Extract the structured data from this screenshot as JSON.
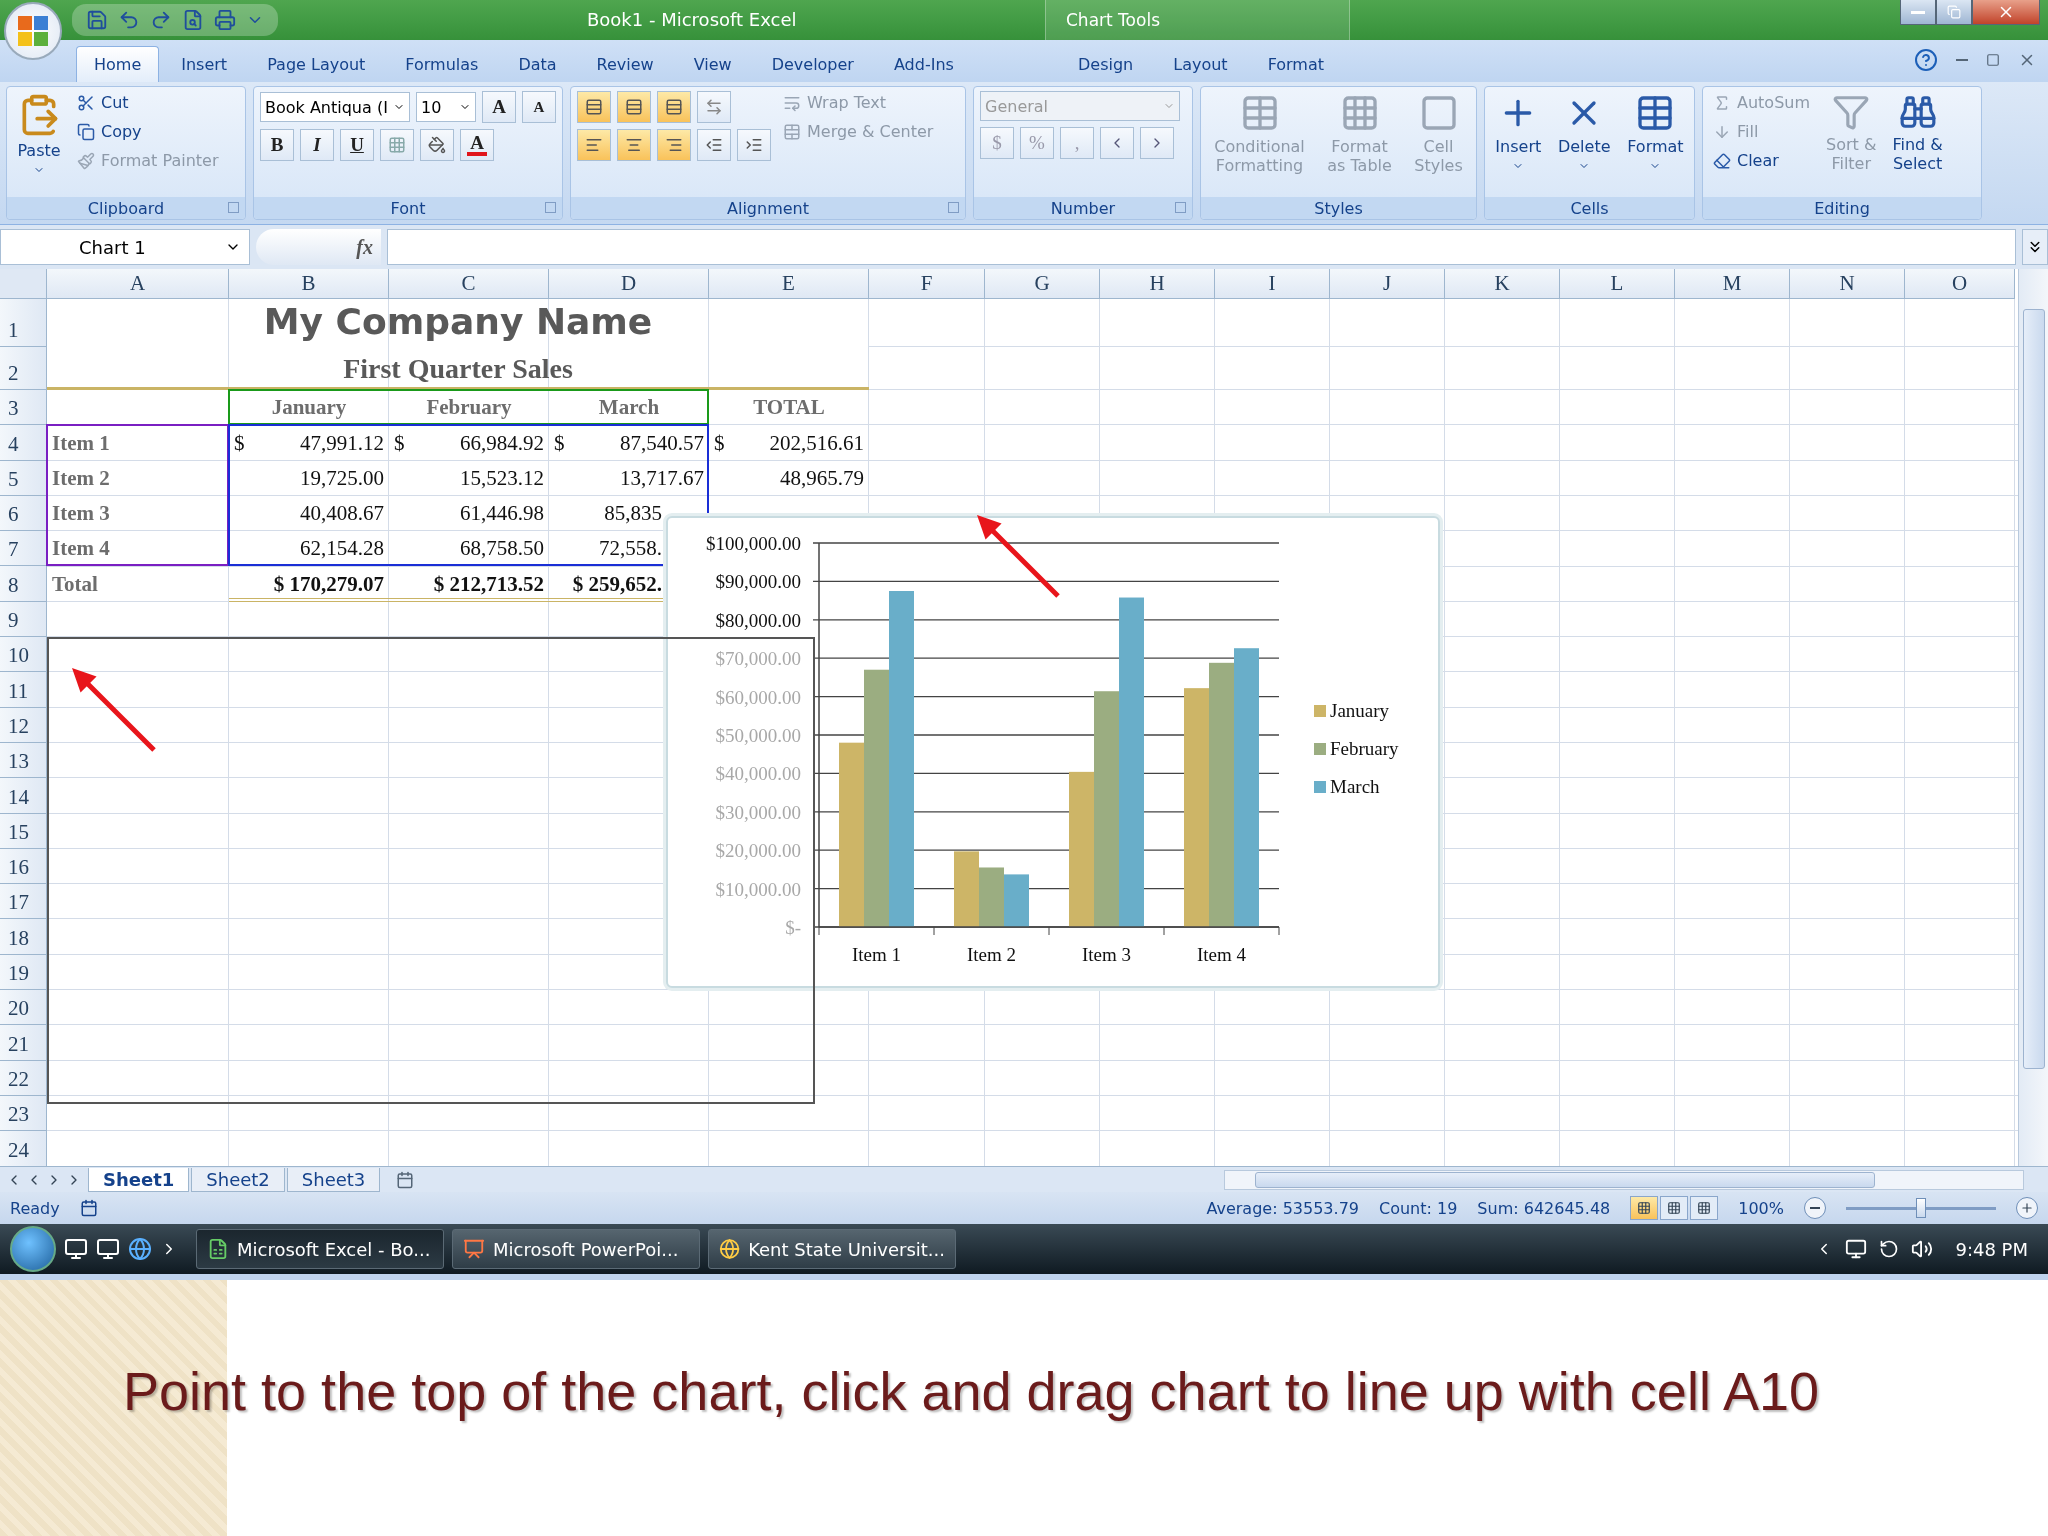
{
  "window": {
    "title": "Book1 - Microsoft Excel",
    "context_title": "Chart Tools"
  },
  "ribbon_tabs": [
    {
      "label": "Home",
      "selected": true
    },
    {
      "label": "Insert",
      "selected": false
    },
    {
      "label": "Page Layout",
      "selected": false
    },
    {
      "label": "Formulas",
      "selected": false
    },
    {
      "label": "Data",
      "selected": false
    },
    {
      "label": "Review",
      "selected": false
    },
    {
      "label": "View",
      "selected": false
    },
    {
      "label": "Developer",
      "selected": false
    },
    {
      "label": "Add-Ins",
      "selected": false
    }
  ],
  "chart_tools_tabs": [
    {
      "label": "Design",
      "selected": false
    },
    {
      "label": "Layout",
      "selected": false
    },
    {
      "label": "Format",
      "selected": false
    }
  ],
  "clipboard": {
    "title": "Clipboard",
    "paste": "Paste",
    "items": [
      {
        "label": "Cut",
        "disabled": false
      },
      {
        "label": "Copy",
        "disabled": false
      },
      {
        "label": "Format Painter",
        "disabled": true
      }
    ]
  },
  "font": {
    "title": "Font",
    "family": "Book Antiqua (I",
    "size": "10",
    "grow": "A",
    "shrink": "A",
    "bold": "B",
    "italic": "I",
    "underline": "U",
    "color_glyph": "A"
  },
  "alignment": {
    "title": "Alignment",
    "buttons": [
      {
        "selected": true
      },
      {
        "selected": true
      },
      {
        "selected": true
      },
      {
        "selected": true
      },
      {
        "selected": true
      },
      {
        "selected": true
      }
    ],
    "wrap": {
      "label": "Wrap Text",
      "disabled": true
    },
    "merge": {
      "label": "Merge & Center",
      "disabled": true
    }
  },
  "number": {
    "title": "Number",
    "format": "General",
    "disabled": true,
    "symbols": [
      "$",
      "%",
      ","
    ]
  },
  "styles": {
    "title": "Styles",
    "items": [
      {
        "label": "Conditional\nFormatting",
        "disabled": true
      },
      {
        "label": "Format\nas Table",
        "disabled": true
      },
      {
        "label": "Cell\nStyles",
        "disabled": true
      }
    ]
  },
  "cells": {
    "title": "Cells",
    "items": [
      {
        "label": "Insert",
        "disabled": false
      },
      {
        "label": "Delete",
        "disabled": false
      },
      {
        "label": "Format",
        "disabled": false
      }
    ]
  },
  "editing": {
    "title": "Editing",
    "small": [
      {
        "label": "AutoSum",
        "disabled": true
      },
      {
        "label": "Fill",
        "disabled": true
      },
      {
        "label": "Clear",
        "disabled": false
      }
    ],
    "big": [
      {
        "label": "Sort &\nFilter",
        "disabled": true
      },
      {
        "label": "Find &\nSelect",
        "disabled": false
      }
    ]
  },
  "formula_bar": {
    "name_box": "Chart 1",
    "fx": "fx"
  },
  "sheet": {
    "columns": [
      "A",
      "B",
      "C",
      "D",
      "E",
      "F",
      "G",
      "H",
      "I",
      "J",
      "K",
      "L",
      "M",
      "N",
      "O"
    ],
    "rows": [
      {
        "number": "1",
        "kind": "title",
        "text": "My Company Name"
      },
      {
        "number": "2",
        "kind": "subtitle",
        "text": "First Quarter Sales"
      },
      {
        "number": "3",
        "kind": "header",
        "values": [
          {
            "amount": "January"
          },
          {
            "amount": "February"
          },
          {
            "amount": "March"
          },
          {
            "amount": "TOTAL"
          }
        ]
      },
      {
        "number": "4",
        "kind": "data",
        "label": "Item 1",
        "values": [
          {
            "symbol": "$",
            "amount": "47,991.12"
          },
          {
            "symbol": "$",
            "amount": "66,984.92"
          },
          {
            "symbol": "$",
            "amount": "87,540.57"
          },
          {
            "symbol": "$",
            "amount": "202,516.61"
          }
        ]
      },
      {
        "number": "5",
        "kind": "data",
        "label": "Item 2",
        "values": [
          {
            "amount": "19,725.00"
          },
          {
            "amount": "15,523.12"
          },
          {
            "amount": "13,717.67"
          },
          {
            "amount": "48,965.79"
          }
        ]
      },
      {
        "number": "6",
        "kind": "data",
        "label": "Item 3",
        "values": [
          {
            "amount": "40,408.67"
          },
          {
            "amount": "61,446.98"
          },
          {
            "amount": "85,835"
          }
        ]
      },
      {
        "number": "7",
        "kind": "data",
        "label": "Item 4",
        "values": [
          {
            "amount": "62,154.28"
          },
          {
            "amount": "68,758.50"
          },
          {
            "amount": "72,558."
          }
        ]
      },
      {
        "number": "8",
        "kind": "total",
        "label": "Total",
        "values": [
          {
            "amount": "$ 170,279.07"
          },
          {
            "amount": "$ 212,713.52"
          },
          {
            "amount": "$ 259,652."
          }
        ]
      },
      {
        "number": "9"
      },
      {
        "number": "10"
      },
      {
        "number": "11"
      },
      {
        "number": "12"
      },
      {
        "number": "13"
      },
      {
        "number": "14"
      },
      {
        "number": "15"
      },
      {
        "number": "16"
      },
      {
        "number": "17"
      },
      {
        "number": "18"
      },
      {
        "number": "19"
      },
      {
        "number": "20"
      },
      {
        "number": "21"
      },
      {
        "number": "22"
      },
      {
        "number": "23"
      },
      {
        "number": "24"
      }
    ]
  },
  "chart": {
    "chart_data": {
      "type": "bar",
      "categories": [
        "Item 1",
        "Item 2",
        "Item 3",
        "Item 4"
      ],
      "series": [
        {
          "name": "January",
          "color": "#cdb567",
          "values": [
            48000,
            19700,
            40400,
            62200
          ]
        },
        {
          "name": "February",
          "color": "#9bad81",
          "values": [
            67000,
            15500,
            61400,
            68800
          ]
        },
        {
          "name": "March",
          "color": "#69aec9",
          "values": [
            87500,
            13700,
            85800,
            72600
          ]
        }
      ],
      "ylim": [
        0,
        100000
      ],
      "yticks": [
        {
          "value": 0,
          "label": "$-"
        },
        {
          "value": 10000,
          "label": "$10,000.00"
        },
        {
          "value": 20000,
          "label": "$20,000.00"
        },
        {
          "value": 30000,
          "label": "$30,000.00"
        },
        {
          "value": 40000,
          "label": "$40,000.00"
        },
        {
          "value": 50000,
          "label": "$50,000.00"
        },
        {
          "value": 60000,
          "label": "$60,000.00"
        },
        {
          "value": 70000,
          "label": "$70,000.00"
        },
        {
          "value": 80000,
          "label": "$80,000.00"
        },
        {
          "value": 90000,
          "label": "$90,000.00"
        },
        {
          "value": 100000,
          "label": "$100,000.00"
        }
      ],
      "grid": true,
      "legend": true
    }
  },
  "sheet_tabs": [
    {
      "label": "Sheet1",
      "selected": true
    },
    {
      "label": "Sheet2",
      "selected": false
    },
    {
      "label": "Sheet3",
      "selected": false
    }
  ],
  "status_bar": {
    "mode": "Ready",
    "average": "Average: 53553.79",
    "count": "Count: 19",
    "sum": "Sum: 642645.48",
    "views": [
      {
        "selected": true
      },
      {
        "selected": false
      },
      {
        "selected": false
      }
    ],
    "zoom": {
      "label": "100%",
      "level": 0.5
    }
  },
  "taskbar": {
    "tasks": [
      {
        "label": "Microsoft Excel - Bo...",
        "kind": "excel",
        "selected": true
      },
      {
        "label": "Microsoft PowerPoi...",
        "kind": "powerpoint",
        "selected": false
      },
      {
        "label": "Kent State Universit...",
        "kind": "browser",
        "selected": false
      }
    ],
    "time": "9:48 PM"
  },
  "caption": "Point to the top of the chart, click and drag chart to line up with cell A10"
}
